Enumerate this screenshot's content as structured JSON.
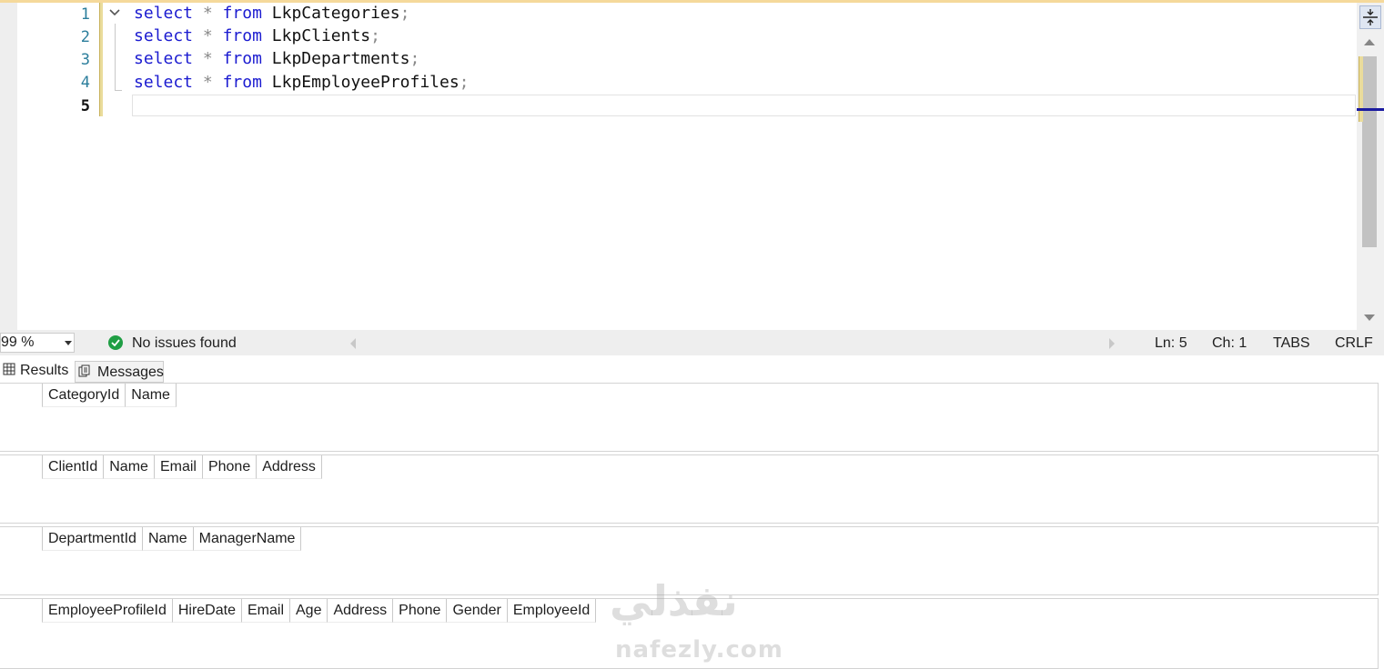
{
  "editor": {
    "line_numbers": [
      "1",
      "2",
      "3",
      "4",
      "5"
    ],
    "current_line": "5",
    "lines": [
      {
        "keyword": "select",
        "star": "*",
        "from": "from",
        "table": "LkpCategories",
        "semicolon": ";"
      },
      {
        "keyword": "select",
        "star": "*",
        "from": "from",
        "table": "LkpClients",
        "semicolon": ";"
      },
      {
        "keyword": "select",
        "star": "*",
        "from": "from",
        "table": "LkpDepartments",
        "semicolon": ";"
      },
      {
        "keyword": "select",
        "star": "*",
        "from": "from",
        "table": "LkpEmployeeProfiles",
        "semicolon": ";"
      }
    ],
    "fold_icon": "chevron-down-icon"
  },
  "status_bar": {
    "zoom": "99 %",
    "issues_icon": "check-circle-icon",
    "issues_text": "No issues found",
    "line": "Ln: 5",
    "char": "Ch: 1",
    "indent": "TABS",
    "line_ending": "CRLF"
  },
  "results_tabs": {
    "results_label": "Results",
    "results_icon": "grid-icon",
    "messages_label": "Messages",
    "messages_icon": "messages-icon"
  },
  "result_sets": [
    {
      "columns": [
        "CategoryId",
        "Name"
      ]
    },
    {
      "columns": [
        "ClientId",
        "Name",
        "Email",
        "Phone",
        "Address"
      ]
    },
    {
      "columns": [
        "DepartmentId",
        "Name",
        "ManagerName"
      ]
    },
    {
      "columns": [
        "EmployeeProfileId",
        "HireDate",
        "Email",
        "Age",
        "Address",
        "Phone",
        "Gender",
        "EmployeeId"
      ]
    }
  ],
  "watermark": {
    "arabic": "نفذلي",
    "latin": "nafezly.com"
  },
  "colors": {
    "keyword": "#1b1bd0",
    "line_number": "#2b7e9c",
    "ok_green": "#1f9e44",
    "change_bar": "#eadc9b"
  }
}
